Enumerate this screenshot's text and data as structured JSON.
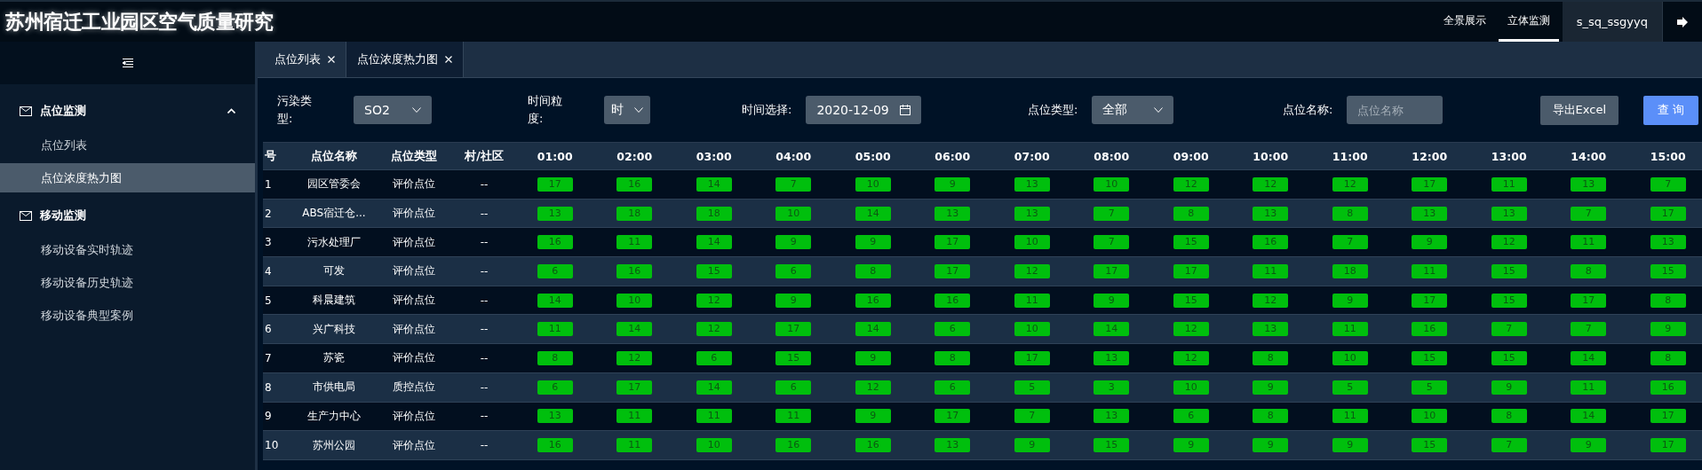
{
  "header": {
    "title": "苏州宿迁工业园区空气质量研究",
    "nav": [
      {
        "label": "全景展示",
        "selected": false
      },
      {
        "label": "立体监测",
        "selected": true
      }
    ],
    "user": "s_sq_ssgyyq"
  },
  "sidebar": {
    "groups": [
      {
        "label": "点位监测",
        "expanded": true,
        "caret": true,
        "items": [
          {
            "label": "点位列表",
            "selected": false
          },
          {
            "label": "点位浓度热力图",
            "selected": true
          }
        ]
      },
      {
        "label": "移动监测",
        "expanded": true,
        "caret": false,
        "items": [
          {
            "label": "移动设备实时轨迹",
            "selected": false
          },
          {
            "label": "移动设备历史轨迹",
            "selected": false
          },
          {
            "label": "移动设备典型案例",
            "selected": false
          }
        ]
      }
    ]
  },
  "tabs": [
    {
      "label": "点位列表",
      "selected": false
    },
    {
      "label": "点位浓度热力图",
      "selected": true
    }
  ],
  "filters": [
    {
      "kind": "select",
      "label": "污染类型:",
      "value": "SO2"
    },
    {
      "kind": "select",
      "label": "时间粒度:",
      "value": "时"
    },
    {
      "kind": "date",
      "label": "时间选择:",
      "value": "2020-12-09"
    },
    {
      "kind": "select",
      "label": "点位类型:",
      "value": "全部"
    },
    {
      "kind": "input",
      "label": "点位名称:",
      "placeholder": "点位名称"
    }
  ],
  "buttons": [
    {
      "kind": "secondary",
      "label": "导出Excel"
    },
    {
      "kind": "primary",
      "label": "查 询"
    }
  ],
  "table": {
    "columns": [
      "号",
      "点位名称",
      "点位类型",
      "村/社区",
      "01:00",
      "02:00",
      "03:00",
      "04:00",
      "05:00",
      "06:00",
      "07:00",
      "08:00",
      "09:00",
      "10:00",
      "11:00",
      "12:00",
      "13:00",
      "14:00",
      "15:00"
    ],
    "rows": [
      {
        "no": "1",
        "name": "园区管委会",
        "type": "评价点位",
        "village": "--",
        "values": [
          "17",
          "16",
          "14",
          "7",
          "10",
          "9",
          "13",
          "10",
          "12",
          "12",
          "12",
          "17",
          "11",
          "13",
          "7"
        ]
      },
      {
        "no": "2",
        "name": "ABS宿迁仓...",
        "type": "评价点位",
        "village": "--",
        "values": [
          "13",
          "18",
          "18",
          "10",
          "14",
          "13",
          "13",
          "7",
          "8",
          "13",
          "8",
          "13",
          "13",
          "7",
          "17"
        ]
      },
      {
        "no": "3",
        "name": "污水处理厂",
        "type": "评价点位",
        "village": "--",
        "values": [
          "16",
          "11",
          "14",
          "9",
          "9",
          "17",
          "10",
          "7",
          "15",
          "16",
          "7",
          "9",
          "12",
          "11",
          "13"
        ]
      },
      {
        "no": "4",
        "name": "可发",
        "type": "评价点位",
        "village": "--",
        "values": [
          "6",
          "16",
          "15",
          "6",
          "8",
          "17",
          "12",
          "17",
          "17",
          "11",
          "18",
          "11",
          "15",
          "8",
          "15"
        ]
      },
      {
        "no": "5",
        "name": "科晨建筑",
        "type": "评价点位",
        "village": "--",
        "values": [
          "14",
          "10",
          "12",
          "9",
          "16",
          "16",
          "11",
          "9",
          "15",
          "12",
          "9",
          "17",
          "15",
          "17",
          "8"
        ]
      },
      {
        "no": "6",
        "name": "兴广科技",
        "type": "评价点位",
        "village": "--",
        "values": [
          "11",
          "14",
          "12",
          "17",
          "14",
          "6",
          "10",
          "14",
          "12",
          "13",
          "11",
          "16",
          "7",
          "7",
          "9"
        ]
      },
      {
        "no": "7",
        "name": "苏瓷",
        "type": "评价点位",
        "village": "--",
        "values": [
          "8",
          "12",
          "6",
          "15",
          "9",
          "8",
          "17",
          "13",
          "12",
          "8",
          "10",
          "15",
          "15",
          "14",
          "8"
        ]
      },
      {
        "no": "8",
        "name": "市供电局",
        "type": "质控点位",
        "village": "--",
        "values": [
          "6",
          "17",
          "14",
          "6",
          "12",
          "6",
          "5",
          "3",
          "10",
          "9",
          "5",
          "5",
          "9",
          "11",
          "16"
        ]
      },
      {
        "no": "9",
        "name": "生产力中心",
        "type": "评价点位",
        "village": "--",
        "values": [
          "13",
          "11",
          "11",
          "11",
          "9",
          "17",
          "7",
          "13",
          "6",
          "8",
          "11",
          "10",
          "8",
          "14",
          "17"
        ]
      },
      {
        "no": "10",
        "name": "苏州公园",
        "type": "评价点位",
        "village": "--",
        "values": [
          "16",
          "11",
          "10",
          "16",
          "16",
          "13",
          "9",
          "15",
          "9",
          "9",
          "9",
          "15",
          "7",
          "9",
          "17"
        ]
      }
    ]
  }
}
